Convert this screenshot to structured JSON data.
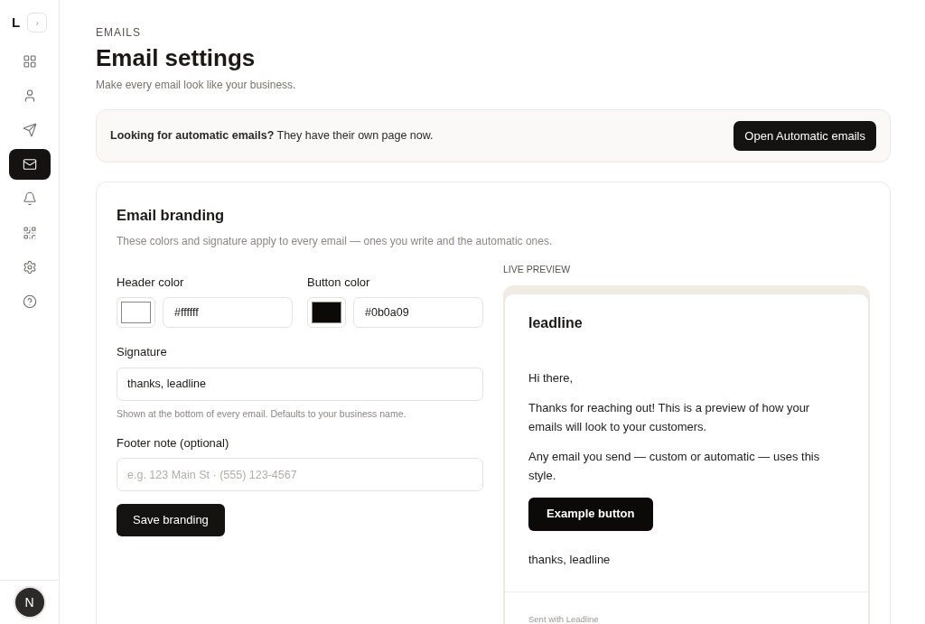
{
  "sidebar": {
    "logo": "L",
    "expand": "›",
    "items": [
      {
        "selected": false
      },
      {
        "selected": false
      },
      {
        "selected": false
      },
      {
        "selected": true
      },
      {
        "selected": false
      },
      {
        "selected": false
      },
      {
        "selected": false
      },
      {
        "selected": false
      }
    ],
    "avatar": "N"
  },
  "header": {
    "eyebrow": "EMAILS",
    "title": "Email settings",
    "subtitle": "Make every email look like your business."
  },
  "notice": {
    "text": "**Looking for automatic emails?** They have their own page now.",
    "button": "Open Automatic emails"
  },
  "branding": {
    "title": "Email branding",
    "description": "These colors and signature apply to every email — ones you write and the automatic ones.",
    "colors": [
      {
        "label": "Header color",
        "value": "#ffffff",
        "color": "#ffffff"
      },
      {
        "label": "Button color",
        "value": "#0b0a09",
        "color": "#0b0a09"
      }
    ],
    "signature": {
      "label": "Signature",
      "value": "thanks, leadline",
      "hint": "Shown at the bottom of every email. Defaults to your business name."
    },
    "footer": {
      "label": "Footer note (optional)",
      "placeholder": "e.g. 123 Main St · (555) 123-4567"
    },
    "save": "Save branding"
  },
  "preview": {
    "label": "LIVE PREVIEW",
    "brand": "leadline",
    "paragraphs": [
      "Hi there,",
      "Thanks for reaching out! This is a preview of how your emails will look to your customers.",
      "Any email you send — custom or automatic — uses this style."
    ],
    "button": "Example button",
    "signature": "thanks, leadline",
    "footer": "Sent with Leadline"
  }
}
